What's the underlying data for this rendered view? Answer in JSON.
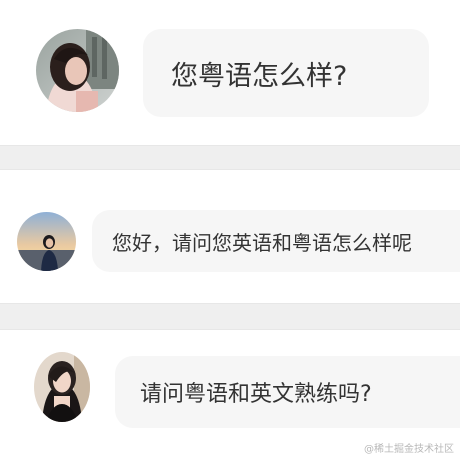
{
  "messages": [
    {
      "text": "您粤语怎么样?"
    },
    {
      "text": "您好，请问您英语和粤语怎么样呢"
    },
    {
      "text": "请问粤语和英文熟练吗?"
    }
  ],
  "watermark": "@稀土掘金技术社区",
  "colors": {
    "bubble": "#f6f6f6",
    "divider": "#efefef",
    "text": "#333333"
  }
}
